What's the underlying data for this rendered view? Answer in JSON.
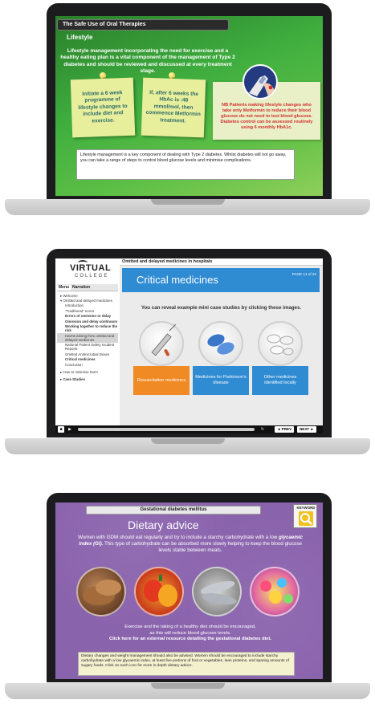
{
  "laptop1": {
    "title": "The Safe Use of Oral Therapies",
    "heading": "Lifestyle",
    "intro": "Lifestyle management incorporating the need for exercise and a healthy eating plan is a vital component of the management of Type 2 diabetes and should be reviewed and discussed at every treatment stage.",
    "note1": "Initiate a 6 week programme of lifestyle changes to include diet and exercise.",
    "note2": "If, after 6 weeks the HbAc is :48 mmol/mol, then commence Metformin treatment.",
    "nb_note": "NB Patients making lifestyle changes who take only Metformin to reduce their blood glucose do not need to test blood glucose. Diabetes control can be assessed routinely using 6 monthly HbA1c.",
    "text_box": "Lifestyle management is a key component of dealing with Type 2 diabetes. Whilst diabetes will not go away, you can take a range of steps to control blood glucose levels and minimise complications.",
    "colors": {
      "background": "#3fae3f",
      "note": "#e7ef9c",
      "nb_text": "#d42d2d"
    }
  },
  "laptop2": {
    "logo_line1": "VIRTUAL",
    "logo_line2": "COLLEGE",
    "tabs": [
      "Menu",
      "Narration"
    ],
    "menu": [
      {
        "label": "Welcome",
        "type": "top"
      },
      {
        "label": "Omitted and delayed medicines",
        "type": "top"
      },
      {
        "label": "Introduction",
        "type": "sub"
      },
      {
        "label": "\"Traditional\" errors",
        "type": "sub"
      },
      {
        "label": "Errors of omission or delay",
        "type": "sub-bold"
      },
      {
        "label": "Omission and delay continuum",
        "type": "sub-bold"
      },
      {
        "label": "Working together to reduce the risk",
        "type": "sub-bold"
      },
      {
        "label": "Harms arising from omitted and delayed medicines",
        "type": "sub-selected"
      },
      {
        "label": "National Patient Safety Incident Reports",
        "type": "sub"
      },
      {
        "label": "Omitted Antimicrobial Doses",
        "type": "sub"
      },
      {
        "label": "Critical medicines",
        "type": "sub-bold"
      },
      {
        "label": "Conclusion",
        "type": "sub"
      },
      {
        "label": "How to minimise harm",
        "type": "top"
      },
      {
        "label": "Case Studies",
        "type": "top-bold"
      }
    ],
    "topbar": "Omitted and delayed medicines in hospitals",
    "banner_title": "Critical medicines",
    "page": "PAGE 14 of 22",
    "instruction": "You can reveal example mini case studies by clicking these images.",
    "cards": [
      {
        "label": "Resuscitation medicines",
        "color": "#f08a24"
      },
      {
        "label": "Medicines for Parkinson's disease",
        "color": "#2f8bd2"
      },
      {
        "label": "Other medicines identified locally",
        "color": "#2f8bd2"
      }
    ],
    "prev": "◄ PREV",
    "next": "NEXT ►",
    "colors": {
      "accent": "#2f8bd2",
      "highlight": "#f08a24"
    }
  },
  "laptop3": {
    "title": "Gestational diabetes mellitus",
    "keyword": "KEYWORD",
    "heading": "Dietary advice",
    "intro_before": "Women with GDM should eat regularly and try to include a starchy carbohydrate with a low ",
    "intro_em": "glycaemic index (GI).",
    "intro_after": " This type of carbohydrate can be absorbed more slowly helping to keep the blood glucose levels stable between meals.",
    "foot_line1": "Exercise and the taking of a healthy diet should be encouraged,",
    "foot_line2": "as this will reduce blood glucose levels.",
    "foot_link": "Click here for an external resource detailing the gestational diabetes diet.",
    "text_box": "Dietary changes and weight management should also be advised. Women should be encouraged to include starchy carbohydrate with a low glycaemic index, at least five portions of fruit or vegetables, lean proteins, and sparing amounts of sugary foods. Click on each icon for more in depth dietary advice.",
    "photos": [
      "bread",
      "peppers",
      "fish",
      "sweets"
    ],
    "colors": {
      "background": "#8a63ad",
      "keyword_icon": "#f2c01f"
    }
  }
}
